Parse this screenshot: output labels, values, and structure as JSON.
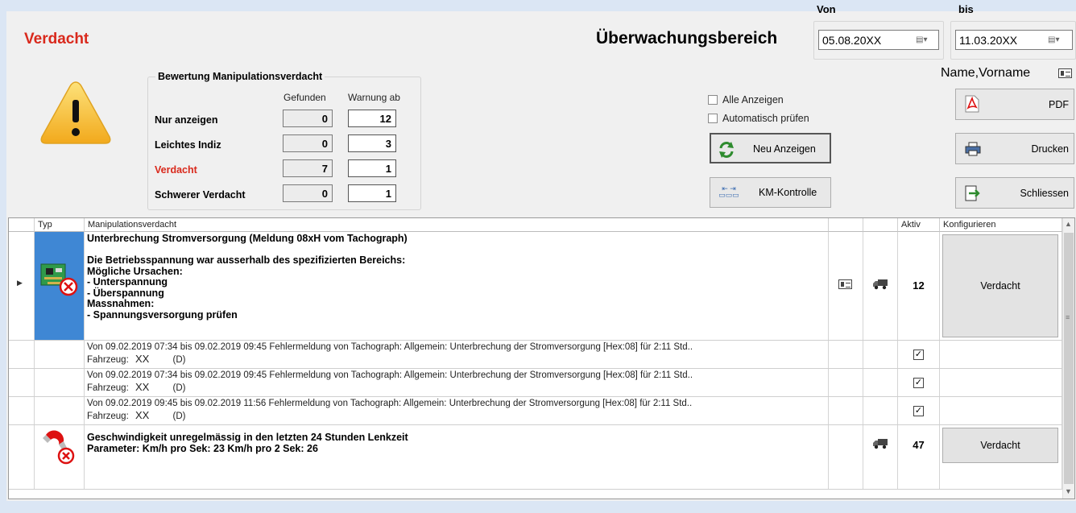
{
  "header": {
    "title": "Verdacht",
    "monitoring_label": "Überwachungsbereich",
    "from_label": "Von",
    "from_date": "05.08.20XX",
    "to_label": "bis",
    "to_date": "11.03.20XX",
    "name_label": "Name,Vorname"
  },
  "rating": {
    "group_label": "Bewertung Manipulationsverdacht",
    "col_found": "Gefunden",
    "col_warning": "Warnung ab",
    "rows": [
      {
        "label": "Nur anzeigen",
        "found": "0",
        "warning": "12"
      },
      {
        "label": "Leichtes Indiz",
        "found": "0",
        "warning": "3"
      },
      {
        "label": "Verdacht",
        "found": "7",
        "warning": "1"
      },
      {
        "label": "Schwerer Verdacht",
        "found": "0",
        "warning": "1"
      }
    ]
  },
  "options": {
    "show_all": "Alle Anzeigen",
    "auto_check": "Automatisch prüfen"
  },
  "buttons": {
    "refresh": "Neu Anzeigen",
    "km_check": "KM-Kontrolle",
    "pdf": "PDF",
    "print": "Drucken",
    "close": "Schliessen"
  },
  "grid": {
    "columns": {
      "typ": "Typ",
      "manip": "Manipulationsverdacht",
      "aktiv": "Aktiv",
      "config": "Konfigurieren"
    },
    "group1": {
      "message": "Unterbrechung Stromversorgung (Meldung 08xH vom Tachograph)\n\nDie Betriebsspannung war ausserhalb des spezifizierten Bereichs:\nMögliche Ursachen:\n- Unterspannung\n- Überspannung\nMassnahmen:\n- Spannungsversorgung prüfen",
      "aktiv": "12",
      "config": "Verdacht"
    },
    "details": [
      {
        "line": "Von 09.02.2019 07:34 bis 09.02.2019 09:45 Fehlermeldung von Tachograph: Allgemein: Unterbrechung der Stromversorgung [Hex:08] für 2:11 Std..",
        "vehicle_label": "Fahrzeug:",
        "vehicle": "XX",
        "country": "(D)"
      },
      {
        "line": "Von 09.02.2019 07:34 bis 09.02.2019 09:45 Fehlermeldung von Tachograph: Allgemein: Unterbrechung der Stromversorgung [Hex:08] für 2:11 Std..",
        "vehicle_label": "Fahrzeug:",
        "vehicle": "XX",
        "country": "(D)"
      },
      {
        "line": "Von 09.02.2019 09:45 bis 09.02.2019 11:56 Fehlermeldung von Tachograph: Allgemein: Unterbrechung der Stromversorgung [Hex:08] für 2:11 Std..",
        "vehicle_label": "Fahrzeug:",
        "vehicle": "XX",
        "country": "(D)"
      }
    ],
    "group2": {
      "message": "Geschwindigkeit unregelmässig in den letzten 24 Stunden Lenkzeit\nParameter: Km/h pro Sek: 23  Km/h pro 2 Sek: 26",
      "aktiv": "47",
      "config": "Verdacht"
    }
  },
  "colors": {
    "accent_red": "#d9291c",
    "selected_row": "#3f87d4",
    "warning_yellow": "#f6c51f"
  }
}
